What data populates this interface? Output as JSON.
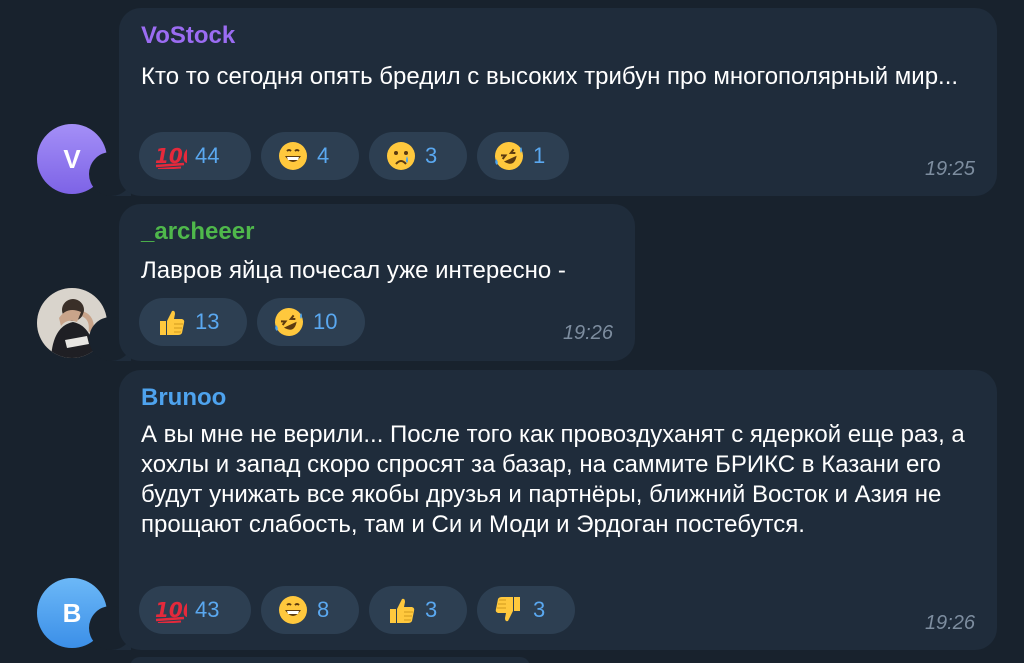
{
  "messages": [
    {
      "avatar_letter": "V",
      "sender": "VoStock",
      "sender_color": "#9b6cf2",
      "text": "Кто то сегодня опять бредил с высоких трибун про многополярный мир...",
      "time": "19:25",
      "reactions": [
        {
          "emoji": "hundred-points-icon",
          "count": "44"
        },
        {
          "emoji": "grinning-face-icon",
          "count": "4"
        },
        {
          "emoji": "crying-face-icon",
          "count": "3"
        },
        {
          "emoji": "rolling-laughing-face-icon",
          "count": "1"
        }
      ]
    },
    {
      "avatar_letter": "",
      "sender": "_archeeer",
      "sender_color": "#4fb84b",
      "text": "Лавров яйца почесал уже интересно -",
      "time": "19:26",
      "reactions": [
        {
          "emoji": "thumbs-up-icon",
          "count": "13"
        },
        {
          "emoji": "rolling-laughing-face-icon",
          "count": "10"
        }
      ]
    },
    {
      "avatar_letter": "B",
      "sender": "Brunoo",
      "sender_color": "#4ea3ee",
      "text": "А вы мне не верили... После того как провоздуханят с ядеркой еще раз, а хохлы и запад скоро спросят за базар, на саммите БРИКС в Казани его будут унижать все якобы друзья и партнёры, ближний Восток и Азия не прощают слабость, там и Си и Моди и Эрдоган постебутся.",
      "time": "19:26",
      "reactions": [
        {
          "emoji": "hundred-points-icon",
          "count": "43"
        },
        {
          "emoji": "grinning-face-icon",
          "count": "8"
        },
        {
          "emoji": "thumbs-up-icon",
          "count": "3"
        },
        {
          "emoji": "thumbs-down-icon",
          "count": "3"
        }
      ]
    }
  ]
}
